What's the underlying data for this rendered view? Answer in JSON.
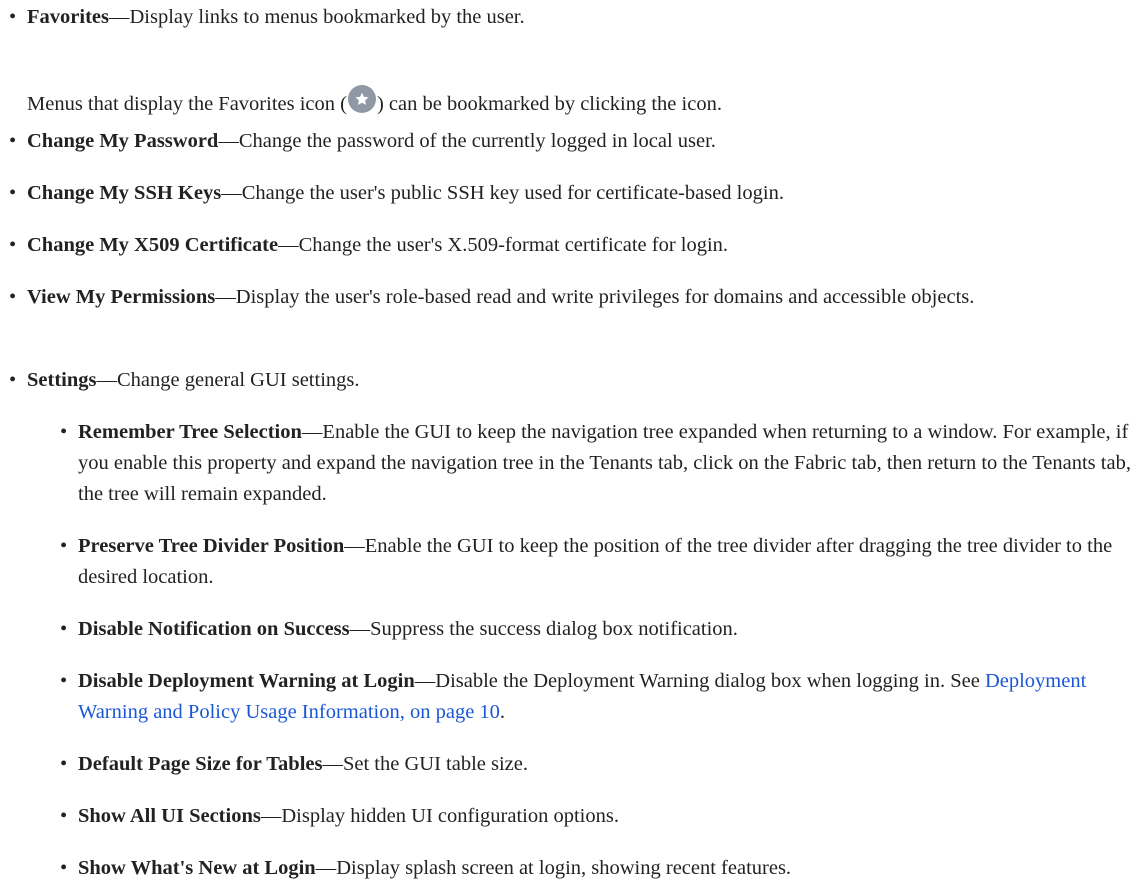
{
  "intro_items": [
    {
      "term": "Favorites",
      "desc": "—Display links to menus bookmarked by the user."
    }
  ],
  "favorites_note": {
    "before": "Menus that display the Favorites icon (",
    "icon": "star-icon",
    "after": ") can be bookmarked by clicking the icon."
  },
  "items": [
    {
      "term": "Change My Password",
      "desc": "—Change the password of the currently logged in local user."
    },
    {
      "term": "Change My SSH Keys",
      "desc": "—Change the user's public SSH key used for certificate-based login."
    },
    {
      "term": "Change My X509 Certificate",
      "desc": "—Change the user's X.509-format certificate for login."
    },
    {
      "term": "View My Permissions",
      "desc": "—Display the user's role-based read and write privileges for domains and accessible objects."
    },
    {
      "term": "Settings",
      "desc": "—Change general GUI settings."
    }
  ],
  "settings_items": [
    {
      "term": "Remember Tree Selection",
      "desc": "—Enable the GUI to keep the navigation tree expanded when returning to a window. For example, if you enable this property and expand the navigation tree in the Tenants tab, click on the Fabric tab, then return to the Tenants tab, the tree will remain expanded."
    },
    {
      "term": "Preserve Tree Divider Position",
      "desc": "—Enable the GUI to keep the position of the tree divider after dragging the tree divider to the desired location."
    },
    {
      "term": "Disable Notification on Success",
      "desc": "—Suppress the success dialog box notification."
    },
    {
      "term": "Disable Deployment Warning at Login",
      "desc": "—Disable the Deployment Warning dialog box when logging in. See ",
      "link": "Deployment Warning and Policy Usage Information, on page 10",
      "after_link": "."
    },
    {
      "term": "Default Page Size for Tables",
      "desc": "—Set the GUI table size."
    },
    {
      "term": "Show All UI Sections",
      "desc": "—Display hidden UI configuration options."
    },
    {
      "term": "Show What's New at Login",
      "desc": "—Display splash screen at login, showing recent features."
    }
  ],
  "bullet": "•",
  "colors": {
    "text": "#222222",
    "link": "#1a57d6",
    "icon_bg": "#8f98a4"
  }
}
